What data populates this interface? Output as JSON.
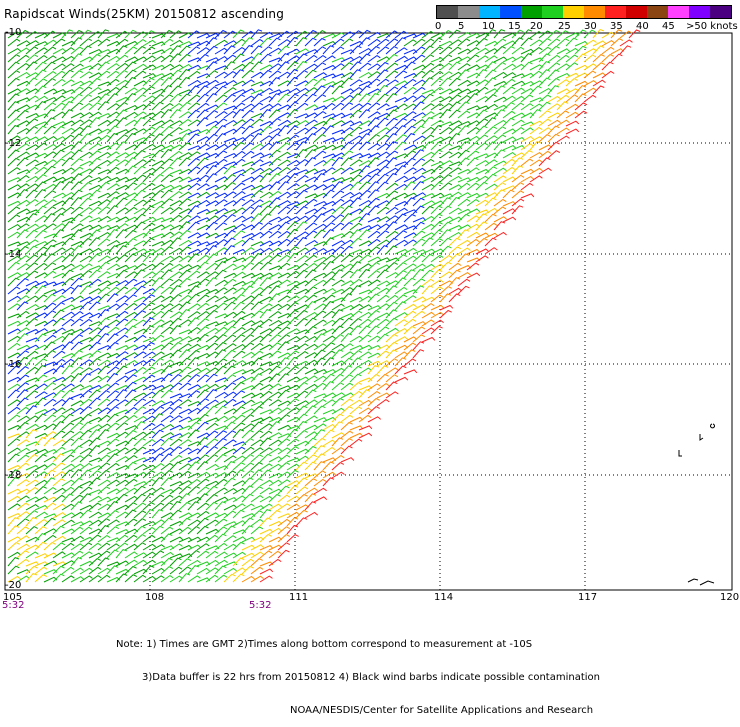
{
  "title": "Rapidscat Winds(25KM) 20150812 ascending",
  "colorbar": {
    "colors": [
      "#505050",
      "#8c8c8c",
      "#00b4ff",
      "#0050ff",
      "#00a000",
      "#20d020",
      "#ffd000",
      "#ff8c00",
      "#ff2020",
      "#d00000",
      "#8b4513",
      "#ff40ff",
      "#8000ff",
      "#4b0082"
    ],
    "labels": [
      "0",
      "5",
      "10",
      "15",
      "20",
      "25",
      "30",
      "35",
      "40",
      "45",
      ">50 knots"
    ]
  },
  "axes": {
    "lat_labels": [
      "-10",
      "-12",
      "-14",
      "-16",
      "-18",
      "-20"
    ],
    "lon_labels": [
      "105",
      "108",
      "111",
      "114",
      "117",
      "120"
    ]
  },
  "time_labels": [
    "5:32",
    "5:32"
  ],
  "notes": [
    "Note: 1) Times are GMT 2)Times along bottom correspond to measurement at -10S",
    "3)Data buffer is 22 hrs from 20150812 4) Black wind barbs indicate possible contamination",
    "NOAA/NESDIS/Center for Satellite Applications and Research"
  ]
}
